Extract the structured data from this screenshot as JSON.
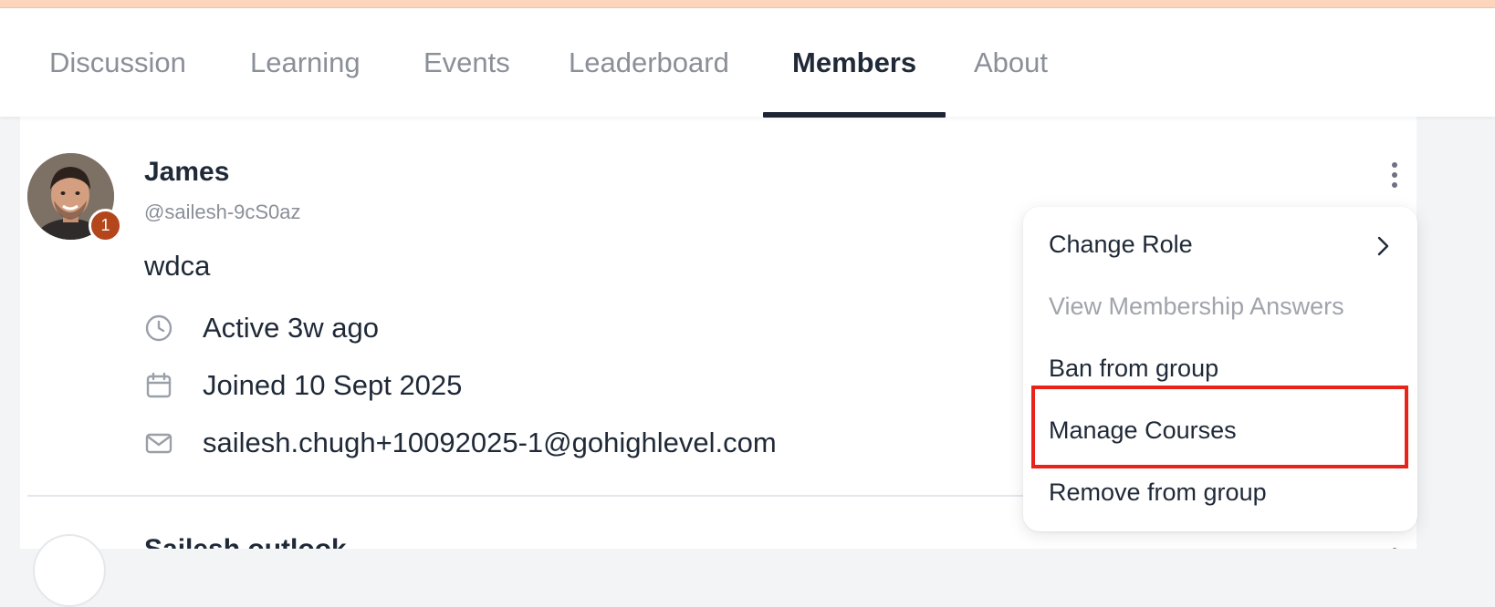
{
  "tabs": [
    {
      "label": "Discussion",
      "active": false
    },
    {
      "label": "Learning",
      "active": false
    },
    {
      "label": "Events",
      "active": false
    },
    {
      "label": "Leaderboard",
      "active": false
    },
    {
      "label": "Members",
      "active": true
    },
    {
      "label": "About",
      "active": false
    }
  ],
  "member": {
    "name": "James",
    "handle": "@sailesh-9cS0az",
    "bio": "wdca",
    "level_badge": "1",
    "active": "Active 3w ago",
    "joined": "Joined 10 Sept 2025",
    "email": "sailesh.chugh+10092025-1@gohighlevel.com"
  },
  "next_member": {
    "name": "Sailesh outlook"
  },
  "context_menu": {
    "items": [
      {
        "label": "Change Role",
        "disabled": false,
        "has_submenu": true
      },
      {
        "label": "View Membership Answers",
        "disabled": true
      },
      {
        "label": "Ban from group",
        "disabled": false
      },
      {
        "label": "Manage Courses",
        "disabled": false,
        "highlighted": true
      },
      {
        "label": "Remove from group",
        "disabled": false
      }
    ]
  },
  "icons": {
    "active": "clock-icon",
    "joined": "calendar-icon",
    "email": "mail-icon",
    "more": "more-vertical-icon",
    "submenu": "chevron-right-icon"
  },
  "colors": {
    "top_strip": "#fcd5bc",
    "active_tab_underline": "#1e2535",
    "badge": "#b4461c",
    "highlight_box": "#e8241a"
  }
}
